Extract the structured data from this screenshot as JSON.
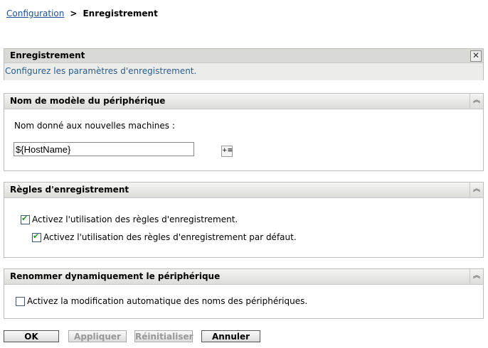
{
  "breadcrumb": {
    "parent": "Configuration",
    "separator": ">",
    "current": "Enregistrement"
  },
  "intro": {
    "title": "Enregistrement",
    "description": "Configurez les paramètres d'enregistrement.",
    "close": "✕"
  },
  "device_name": {
    "title": "Nom de modèle du périphérique",
    "label": "Nom donné aux nouvelles machines :",
    "value": "${HostName}"
  },
  "rules": {
    "title": "Règles d'enregistrement",
    "enable_rules": {
      "label": "Activez l'utilisation des règles d'enregistrement.",
      "checked": true
    },
    "enable_default": {
      "label": "Activez l'utilisation des règles d'enregistrement par défaut.",
      "checked": true
    }
  },
  "rename": {
    "title": "Renommer dynamiquement le périphérique",
    "enable_rename": {
      "label": "Activez la modification automatique des noms des périphériques.",
      "checked": false
    }
  },
  "collapse_glyph": "︽",
  "buttons": {
    "ok": "OK",
    "apply": "Appliquer",
    "reset": "Réinitialiser",
    "cancel": "Annuler"
  }
}
